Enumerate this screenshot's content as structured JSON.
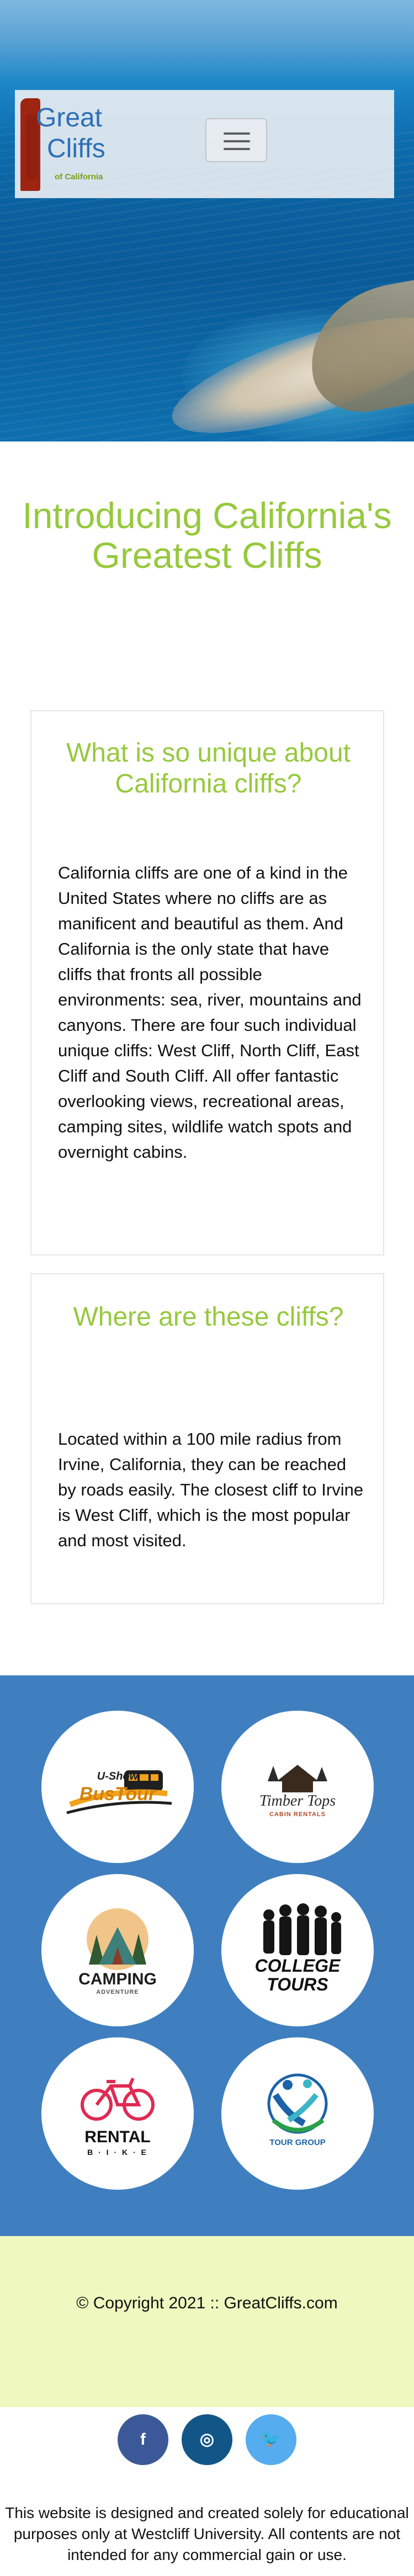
{
  "header": {
    "logo_line1": "Great",
    "logo_line2": "Cliffs",
    "logo_tagline": "of California",
    "menu_toggle_icon": "hamburger-icon"
  },
  "intro": {
    "title": "Introducing California's Greatest Cliffs"
  },
  "cards": [
    {
      "heading": "What is so unique about California cliffs?",
      "body": "California cliffs are one of a kind in the United States where no cliffs are as manificent and beautiful as them. And California is the only state that have cliffs that fronts all possible environments: sea, river, mountains and canyons. There are four such individual unique cliffs: West Cliff, North Cliff, East Cliff and South Cliff. All offer fantastic overlooking views, recreational areas, camping sites, wildlife watch spots and overnight cabins."
    },
    {
      "heading": "Where are these cliffs?",
      "body": "Located within a 100 mile radius from Irvine, California, they can be reached by roads easily. The closest cliff to Irvine is West Cliff, which is the most popular and most visited."
    }
  ],
  "partners": [
    {
      "name": "U-Show Bus Tour",
      "line1": "U-Show",
      "line2": "BusTour"
    },
    {
      "name": "Timber Tops Cabin Rentals",
      "line1": "Timber Tops",
      "line2": "CABIN RENTALS"
    },
    {
      "name": "Camping Adventure",
      "line1": "CAMPING",
      "line2": "ADVENTURE"
    },
    {
      "name": "College Tours",
      "line1": "COLLEGE",
      "line2": "TOURS"
    },
    {
      "name": "Rental Bike",
      "line1": "RENTAL",
      "line2": "B · I · K · E"
    },
    {
      "name": "Tour Group",
      "line1": "TOUR GROUP",
      "line2": ""
    }
  ],
  "footer": {
    "copyright": "© Copyright 2021 :: GreatCliffs.com",
    "social": [
      {
        "label": "f",
        "icon": "facebook-icon",
        "color": "#3b5998"
      },
      {
        "label": "◎",
        "icon": "instagram-icon",
        "color": "#125688"
      },
      {
        "label": "🐦",
        "icon": "twitter-icon",
        "color": "#55acee"
      }
    ],
    "disclaimer": "This website is designed and created solely for educational purposes only at Westcliff University. All contents are not intended for any commercial gain or use."
  },
  "colors": {
    "accent_green": "#96c93d",
    "partners_blue": "#3f7fc0",
    "footer_bg": "#eff9bf",
    "logo_blue": "#2d6fb6"
  }
}
